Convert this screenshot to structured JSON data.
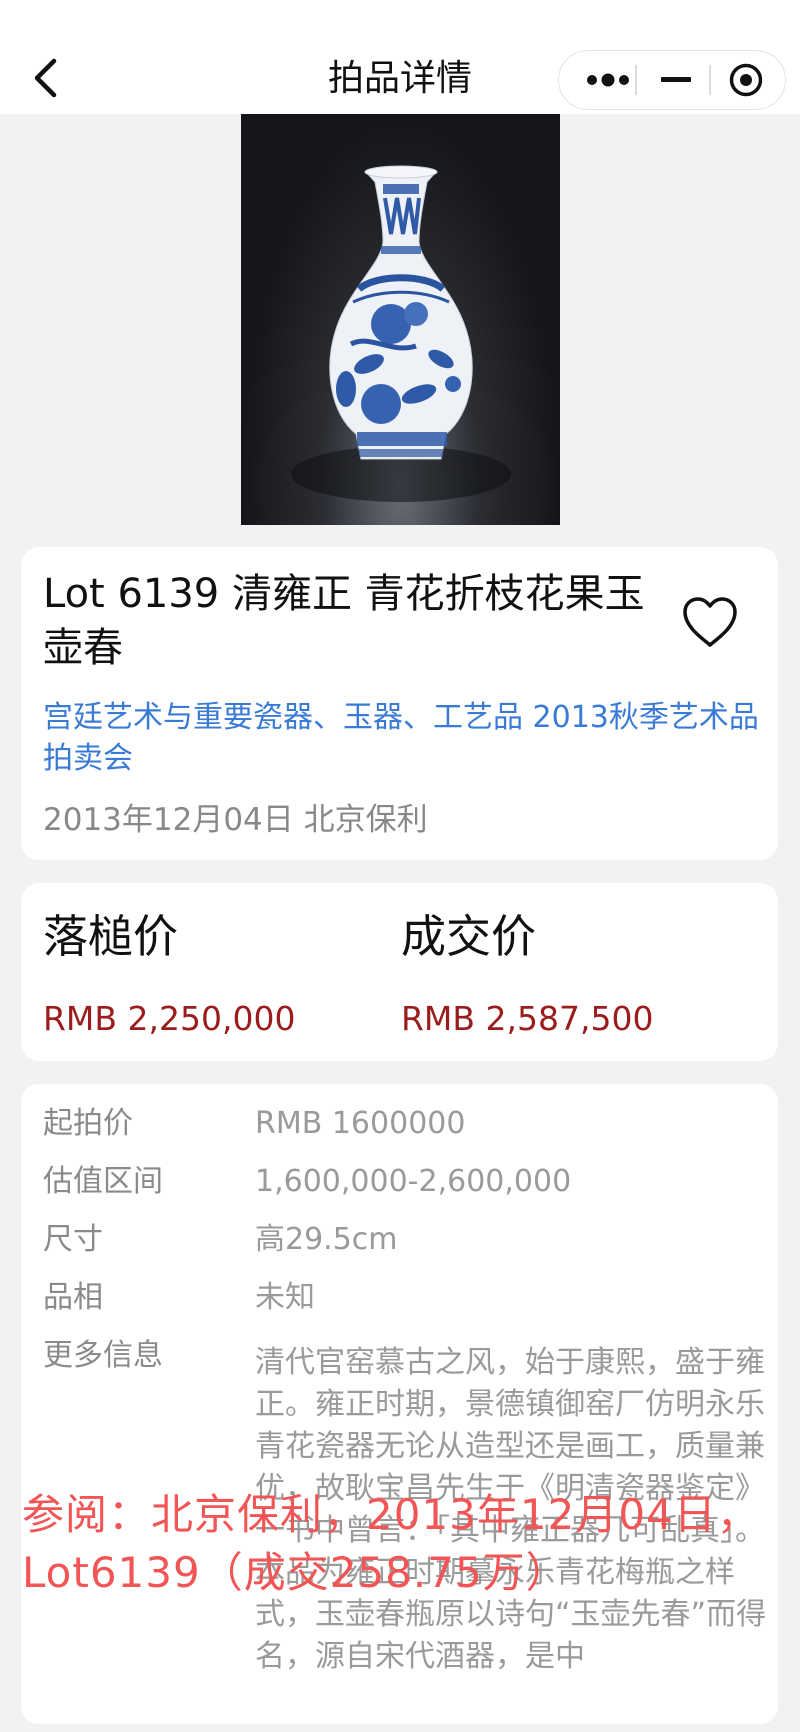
{
  "nav": {
    "title": "拍品详情",
    "back_icon": "chevron-left-icon",
    "more_icon": "more-dots-icon",
    "minimize_icon": "minimize-icon",
    "close_icon": "target-circle-icon"
  },
  "hero": {
    "image_icon": "vase-photo"
  },
  "lot": {
    "title": "Lot 6139 清雍正 青花折枝花果玉壶春",
    "sale_name": "宫廷艺术与重要瓷器、玉器、工艺品 2013秋季艺术品拍卖会",
    "date_house": "2013年12月04日 北京保利",
    "favorite_icon": "heart-outline-icon"
  },
  "prices": {
    "hammer_label": "落槌价",
    "hammer_value": "RMB 2,250,000",
    "deal_label": "成交价",
    "deal_value": "RMB 2,587,500"
  },
  "info": {
    "start_label": "起拍价",
    "start_value": "RMB 1600000",
    "estimate_label": "估值区间",
    "estimate_value": "1,600,000-2,600,000",
    "size_label": "尺寸",
    "size_value": "高29.5cm",
    "condition_label": "品相",
    "condition_value": "未知",
    "more_label": "更多信息",
    "more_p1": "清代官窑慕古之风，始于康熙，盛于雍正。雍正时期，景德镇御窑厂仿明永乐青花瓷器无论从造型还是画工，质量兼优，故耿宝昌先生于《明清瓷器鉴定》一书中曾言：「其中雍正器几可乱真」。",
    "more_p2": "本品为雍正时期摹永乐青花梅瓶之样式，玉壶春瓶原以诗句“玉壶先春”而得名，源自宋代酒器，是中"
  },
  "overlay": {
    "text": "参阅：北京保利，2013年12月04日，Lot6139（成交258.75万）"
  }
}
